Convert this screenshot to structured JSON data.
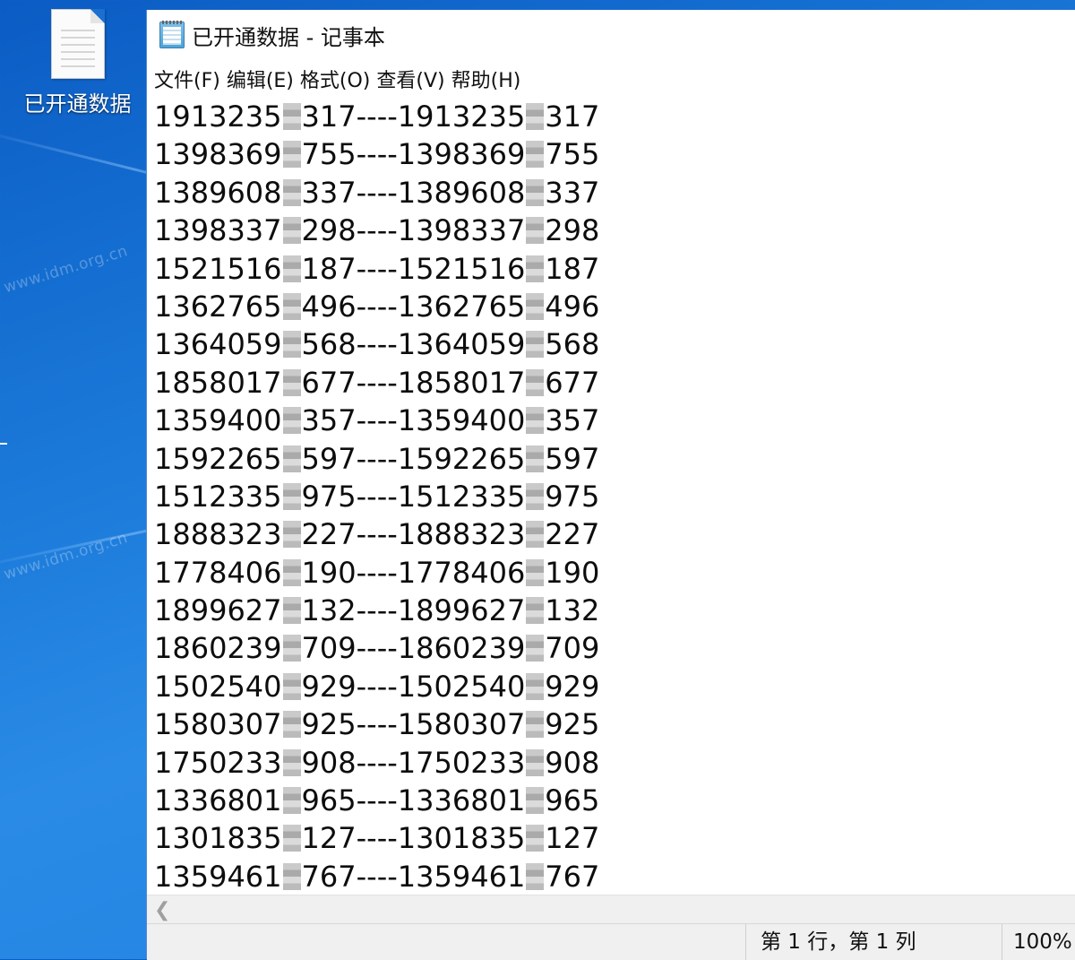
{
  "desktop": {
    "icon_label": "已开通数据",
    "watermark": "www.idm.org.cn"
  },
  "window": {
    "title": "已开通数据 - 记事本",
    "menu": [
      "文件(F)",
      "编辑(E)",
      "格式(O)",
      "查看(V)",
      "帮助(H)"
    ],
    "lines": [
      {
        "a": "1913235",
        "b": "317",
        "c": "1913235",
        "d": "317"
      },
      {
        "a": "1398369",
        "b": "755",
        "c": "1398369",
        "d": "755"
      },
      {
        "a": "1389608",
        "b": "337",
        "c": "1389608",
        "d": "337"
      },
      {
        "a": "1398337",
        "b": "298",
        "c": "1398337",
        "d": "298"
      },
      {
        "a": "1521516",
        "b": "187",
        "c": "1521516",
        "d": "187"
      },
      {
        "a": "1362765",
        "b": "496",
        "c": "1362765",
        "d": "496"
      },
      {
        "a": "1364059",
        "b": "568",
        "c": "1364059",
        "d": "568"
      },
      {
        "a": "1858017",
        "b": "677",
        "c": "1858017",
        "d": "677"
      },
      {
        "a": "1359400",
        "b": "357",
        "c": "1359400",
        "d": "357"
      },
      {
        "a": "1592265",
        "b": "597",
        "c": "1592265",
        "d": "597"
      },
      {
        "a": "1512335",
        "b": "975",
        "c": "1512335",
        "d": "975"
      },
      {
        "a": "1888323",
        "b": "227",
        "c": "1888323",
        "d": "227"
      },
      {
        "a": "1778406",
        "b": "190",
        "c": "1778406",
        "d": "190"
      },
      {
        "a": "1899627",
        "b": "132",
        "c": "1899627",
        "d": "132"
      },
      {
        "a": "1860239",
        "b": "709",
        "c": "1860239",
        "d": "709"
      },
      {
        "a": "1502540",
        "b": "929",
        "c": "1502540",
        "d": "929"
      },
      {
        "a": "1580307",
        "b": "925",
        "c": "1580307",
        "d": "925"
      },
      {
        "a": "1750233",
        "b": "908",
        "c": "1750233",
        "d": "908"
      },
      {
        "a": "1336801",
        "b": "965",
        "c": "1336801",
        "d": "965"
      },
      {
        "a": "1301835",
        "b": "127",
        "c": "1301835",
        "d": "127"
      },
      {
        "a": "1359461",
        "b": "767",
        "c": "1359461",
        "d": "767"
      }
    ],
    "separator": "----",
    "status": {
      "position": "第 1 行，第 1 列",
      "zoom": "100%"
    }
  }
}
